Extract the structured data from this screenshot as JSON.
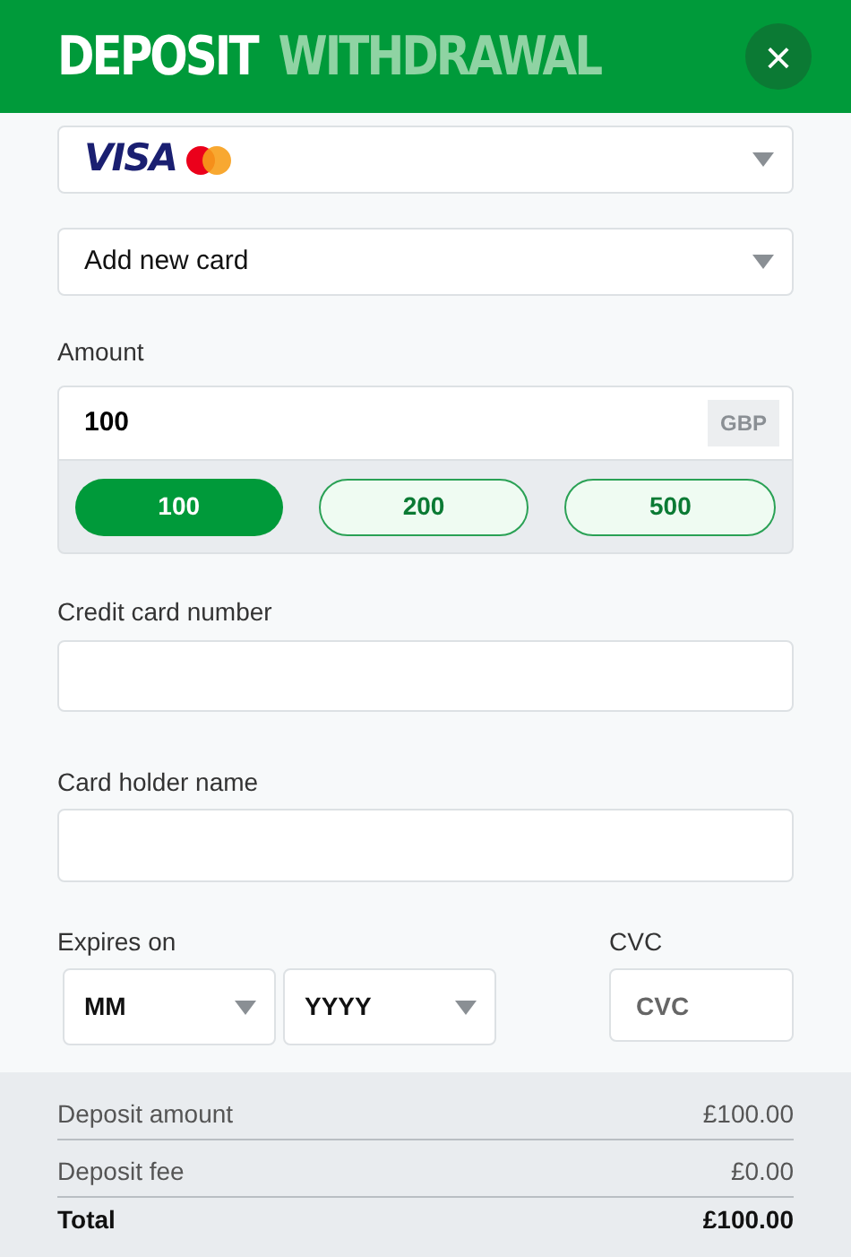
{
  "tabs": [
    {
      "label": "DEPOSIT",
      "selected": true
    },
    {
      "label": "WITHDRAWAL",
      "selected": false
    }
  ],
  "close_button": {
    "label": "×"
  },
  "card_type_select": {
    "logo_text": "VISA"
  },
  "card_select": {
    "value": "Add new card"
  },
  "amount": {
    "label": "Amount",
    "value": "100",
    "currency": "GBP",
    "presets": [
      {
        "label": "100",
        "selected": true
      },
      {
        "label": "200",
        "selected": false
      },
      {
        "label": "500",
        "selected": false
      }
    ]
  },
  "card_number": {
    "label": "Credit card number"
  },
  "holder_name": {
    "label": "Card holder name"
  },
  "expiry": {
    "label": "Expires on",
    "month": "MM",
    "year": "YYYY"
  },
  "cvc": {
    "label": "CVC",
    "placeholder": "CVC"
  },
  "summary": [
    {
      "label": "Deposit amount",
      "value": "£100.00",
      "kind": "line"
    },
    {
      "label": "Deposit fee",
      "value": "£0.00",
      "kind": "line"
    },
    {
      "label": "Total",
      "value": "£100.00",
      "kind": "total"
    }
  ]
}
